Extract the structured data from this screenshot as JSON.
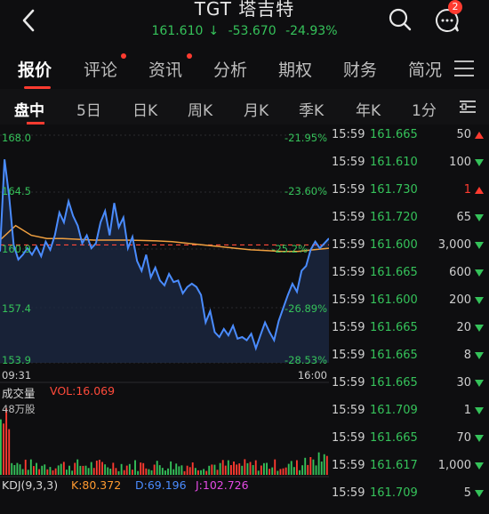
{
  "header": {
    "title": "TGT 塔吉特",
    "price": "161.610",
    "change": "-53.670",
    "change_pct": "-24.93%",
    "notification_count": "2"
  },
  "tabs": [
    {
      "label": "报价",
      "active": true
    },
    {
      "label": "评论",
      "dot": true
    },
    {
      "label": "资讯",
      "dot": true
    },
    {
      "label": "分析"
    },
    {
      "label": "期权"
    },
    {
      "label": "财务"
    },
    {
      "label": "简况"
    }
  ],
  "periods": [
    "盘中",
    "5日",
    "日K",
    "周K",
    "月K",
    "季K",
    "年K",
    "1分"
  ],
  "chart": {
    "y_left": [
      "168.0",
      "164.5",
      "160.9",
      "157.4",
      "153.9"
    ],
    "y_right": [
      "-21.95%",
      "-23.60%",
      "-25.2%",
      "-26.89%",
      "-28.53%"
    ],
    "x_start": "09:31",
    "x_end": "16:00",
    "volume_label": "成交量",
    "volume_value": "VOL:16.069",
    "volume_axis": "48万股",
    "kdj_label": "KDJ(9,3,3)",
    "kdj_k": "K:80.372",
    "kdj_d": "D:69.196",
    "kdj_j": "J:102.726",
    "colors": {
      "line": "#4a8cff",
      "avg": "#f0a040",
      "down": "#35c25a",
      "up": "#ff3b30",
      "prev_close": "#ff4a3a"
    }
  },
  "chart_data": {
    "type": "line",
    "title": "",
    "xlabel": "",
    "ylabel": "",
    "x_range": [
      "09:31",
      "16:00"
    ],
    "ylim": [
      153.9,
      168.0
    ],
    "series": [
      {
        "values": [
          160.8,
          166.5,
          164.2,
          161.2,
          160.3,
          160.6,
          161.0,
          160.6,
          161.1,
          160.5,
          161.4,
          160.9,
          161.8,
          163.2,
          162.6,
          163.9,
          163.0,
          162.4,
          161.3,
          161.8,
          161.0,
          161.3,
          162.6,
          163.3,
          161.8,
          163.8,
          162.3,
          162.9,
          161.0,
          161.7,
          160.2,
          159.6,
          160.6,
          159.2,
          159.8,
          159.0,
          158.7,
          159.4,
          158.9,
          159.0,
          158.2,
          158.6,
          158.8,
          158.6,
          158.1,
          156.4,
          157.1,
          155.8,
          155.5,
          156.0,
          155.6,
          156.2,
          155.4,
          155.5,
          155.3,
          155.7,
          154.8,
          155.6,
          156.4,
          155.8,
          155.3,
          156.5,
          157.3,
          158.1,
          158.8,
          158.3,
          159.6,
          159.9,
          160.9,
          161.4,
          161.0,
          161.3,
          161.61
        ]
      },
      {
        "values": [
          161.5,
          162.4,
          161.8,
          161.6,
          161.6,
          161.55,
          161.5,
          161.5,
          161.5,
          161.48,
          161.45,
          161.4,
          161.3,
          161.2,
          161.1,
          161.0,
          160.9,
          160.85,
          160.8,
          160.8,
          160.9,
          161.0
        ]
      }
    ],
    "prev_close": 161.2
  },
  "trades": [
    {
      "time": "15:59",
      "price": "161.665",
      "vol": "50",
      "dir": "up",
      "vcolor": "#cfcfcf"
    },
    {
      "time": "15:59",
      "price": "161.610",
      "vol": "100",
      "dir": "down",
      "vcolor": "#cfcfcf"
    },
    {
      "time": "15:59",
      "price": "161.730",
      "vol": "1",
      "dir": "up",
      "vcolor": "#ff3b30"
    },
    {
      "time": "15:59",
      "price": "161.720",
      "vol": "65",
      "dir": "down",
      "vcolor": "#cfcfcf"
    },
    {
      "time": "15:59",
      "price": "161.600",
      "vol": "3,000",
      "dir": "down",
      "vcolor": "#cfcfcf"
    },
    {
      "time": "15:59",
      "price": "161.665",
      "vol": "600",
      "dir": "down",
      "vcolor": "#cfcfcf"
    },
    {
      "time": "15:59",
      "price": "161.600",
      "vol": "200",
      "dir": "down",
      "vcolor": "#cfcfcf"
    },
    {
      "time": "15:59",
      "price": "161.665",
      "vol": "20",
      "dir": "down",
      "vcolor": "#cfcfcf"
    },
    {
      "time": "15:59",
      "price": "161.665",
      "vol": "8",
      "dir": "down",
      "vcolor": "#cfcfcf"
    },
    {
      "time": "15:59",
      "price": "161.665",
      "vol": "30",
      "dir": "down",
      "vcolor": "#cfcfcf"
    },
    {
      "time": "15:59",
      "price": "161.709",
      "vol": "1",
      "dir": "down",
      "vcolor": "#cfcfcf"
    },
    {
      "time": "15:59",
      "price": "161.665",
      "vol": "70",
      "dir": "down",
      "vcolor": "#cfcfcf"
    },
    {
      "time": "15:59",
      "price": "161.617",
      "vol": "1,000",
      "dir": "down",
      "vcolor": "#cfcfcf"
    },
    {
      "time": "15:59",
      "price": "161.709",
      "vol": "5",
      "dir": "down",
      "vcolor": "#cfcfcf"
    }
  ]
}
